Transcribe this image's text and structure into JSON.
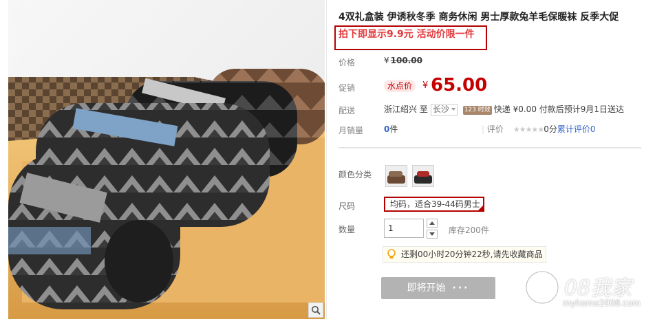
{
  "product": {
    "title": "4双礼盒装 伊诱秋冬季 商务休闲 男士厚款兔羊毛保暖袜 反季大促",
    "promo": "拍下即显示9.9元 活动价限一件"
  },
  "price": {
    "label": "价格",
    "currency": "¥",
    "original": "100.00",
    "promo_label": "促销",
    "tag": "水点价",
    "current": "65.00"
  },
  "shipping": {
    "label": "配送",
    "from": "浙江绍兴",
    "to_word": "至",
    "city": "长沙",
    "badge": "123 时效",
    "method": "快递",
    "fee": "¥0.00",
    "eta": "付款后预计9月1日送达"
  },
  "sales": {
    "label": "月销量",
    "count": "0",
    "unit": "件",
    "rating_label": "评价",
    "stars": "★★★★★",
    "score": "0分",
    "reviews": "累计评价0"
  },
  "options": {
    "color_label": "颜色分类",
    "size_label": "尺码",
    "size_value": "均码，适合39-44码男士",
    "qty_label": "数量",
    "qty_value": "1",
    "stock": "库存200件"
  },
  "notice": "还剩00小时20分钟22秒,请先收藏商品",
  "cta": {
    "label": "即将开始",
    "dots": "···"
  },
  "watermark": {
    "brand": "08我家",
    "url": "myhome2008.com"
  },
  "colors": {
    "accent": "#c40000",
    "promo_red": "#e4393c",
    "link": "#3366cc",
    "button_disabled": "#b3b3b3"
  }
}
